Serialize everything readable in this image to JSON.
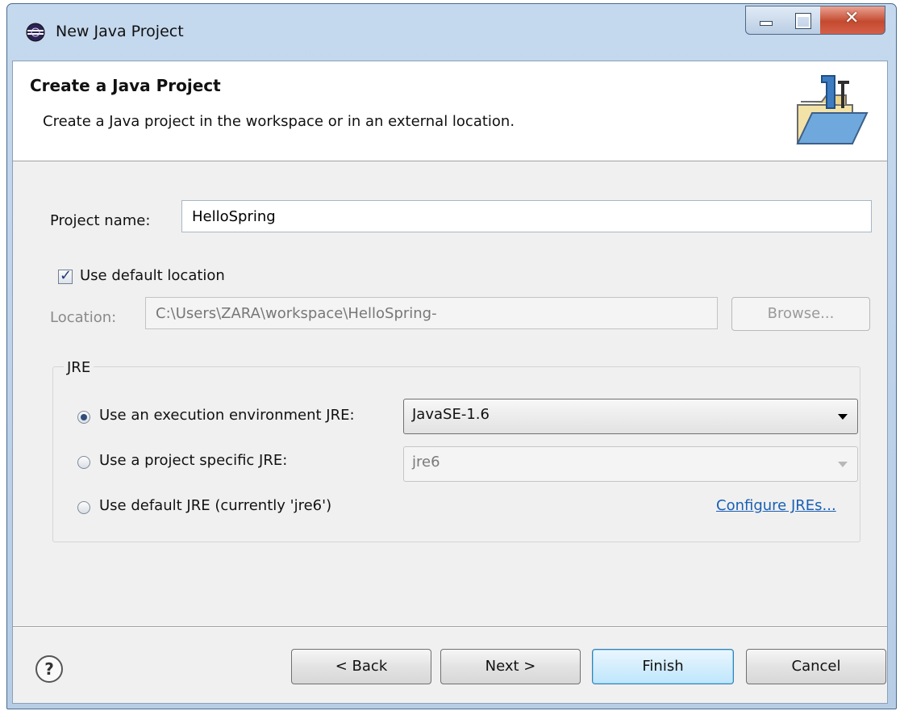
{
  "window": {
    "title": "New Java Project",
    "close_glyph": "✕"
  },
  "banner": {
    "title": "Create a Java Project",
    "description": "Create a Java project in the workspace or in an external location.",
    "icon": "java-project-folder-icon"
  },
  "project_name": {
    "label": "Project name:",
    "value": "HelloSpring"
  },
  "default_location": {
    "label": "Use default location",
    "checked": true
  },
  "location": {
    "label": "Location:",
    "value": "C:\\Users\\ZARA\\workspace\\HelloSpring-",
    "browse_label": "Browse..."
  },
  "jre": {
    "group_label": "JRE",
    "options": [
      {
        "label": "Use an execution environment JRE:",
        "selected": true,
        "combo_value": "JavaSE-1.6"
      },
      {
        "label": "Use a project specific JRE:",
        "selected": false,
        "combo_value": "jre6"
      },
      {
        "label": "Use default JRE (currently 'jre6')",
        "selected": false
      }
    ],
    "configure_link": "Configure JREs..."
  },
  "buttons": {
    "help": "?",
    "back": "< Back",
    "next": "Next >",
    "finish": "Finish",
    "cancel": "Cancel"
  }
}
